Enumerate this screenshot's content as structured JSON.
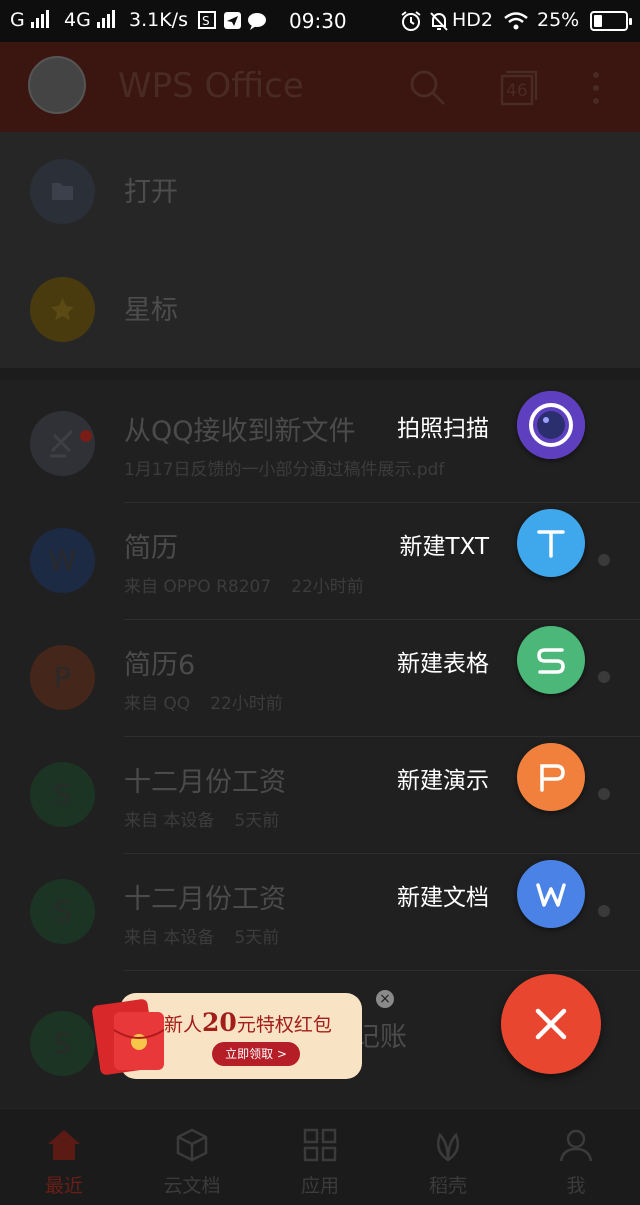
{
  "status_bar": {
    "carrier1": "G",
    "carrier2": "4G",
    "speed": "3.1K/s",
    "time": "09:30",
    "network_type": "HD2",
    "battery": "25%",
    "battery_level": 0.25
  },
  "header": {
    "title": "WPS Office",
    "tab_count": "46"
  },
  "quick_actions": [
    {
      "label": "打开",
      "icon": "folder-icon",
      "color": "#2a2f38"
    },
    {
      "label": "星标",
      "icon": "star-icon",
      "color": "#4a3b0f"
    }
  ],
  "files": [
    {
      "name": "从QQ接收到新文件",
      "source": "1月17日反馈的一小部分通过稿件展示.pdf",
      "time": "",
      "icon_color": "#2f3136",
      "glyph": ""
    },
    {
      "name": "简历",
      "source": "来自 OPPO R8207",
      "time": "22小时前",
      "icon_color": "#1d2a44",
      "glyph": "W"
    },
    {
      "name": "简历6",
      "source": "来自 QQ",
      "time": "22小时前",
      "icon_color": "#45261a",
      "glyph": "P"
    },
    {
      "name": "十二月份工资",
      "source": "来自 本设备",
      "time": "5天前",
      "icon_color": "#1c3424",
      "glyph": "S"
    },
    {
      "name": "十二月份工资",
      "source": "来自 本设备",
      "time": "5天前",
      "icon_color": "#1c3424",
      "glyph": "S"
    },
    {
      "name": "…记账",
      "source": "",
      "time": "",
      "icon_color": "#1c3424",
      "glyph": "S"
    }
  ],
  "speed_dial": [
    {
      "label": "拍照扫描",
      "icon": "camera-icon",
      "color": "#6a4fc7"
    },
    {
      "label": "新建TXT",
      "icon": "txt-icon",
      "color": "#3fa7ec"
    },
    {
      "label": "新建表格",
      "icon": "sheet-icon",
      "color": "#4bb778"
    },
    {
      "label": "新建演示",
      "icon": "slides-icon",
      "color": "#f0803c"
    },
    {
      "label": "新建文档",
      "icon": "doc-icon",
      "color": "#4a82e6"
    }
  ],
  "promo": {
    "title_prefix": "新人",
    "amount": "20",
    "title_suffix": "元特权红包",
    "button": "立即领取 >"
  },
  "bottom_nav": [
    {
      "label": "最近",
      "icon": "home-icon",
      "active": true
    },
    {
      "label": "云文档",
      "icon": "cloud-box-icon",
      "active": false
    },
    {
      "label": "应用",
      "icon": "apps-grid-icon",
      "active": false
    },
    {
      "label": "稻壳",
      "icon": "leaf-icon",
      "active": false
    },
    {
      "label": "我",
      "icon": "person-icon",
      "active": false
    }
  ]
}
